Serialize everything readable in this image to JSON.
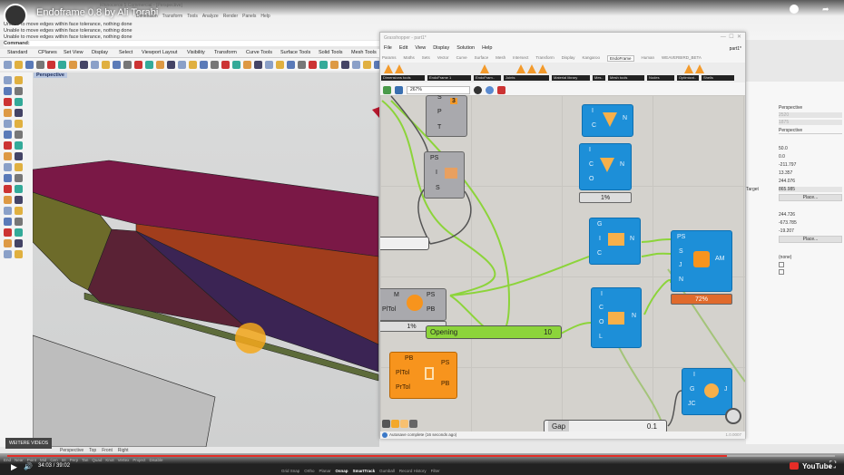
{
  "video": {
    "title": "Endoframe 0.8 by Ali Torabi",
    "time": "34:03 / 39:02",
    "more_videos": "WEITERE VIDEOS",
    "youtube": "YouTube",
    "progress_percent": 87
  },
  "rhino": {
    "window_title": "Rhinoceros 5 Commercial - [Perspective]",
    "menu": [
      "File",
      "Edit",
      "View",
      "Curve",
      "Surface",
      "Solid",
      "Mesh",
      "Dimension",
      "Transform",
      "Tools",
      "Analyze",
      "Render",
      "Panels",
      "Help"
    ],
    "command_history": [
      "Unable to move edges within face tolerance, nothing done",
      "Unable to move edges within face tolerance, nothing done",
      "Unable to move edges within face tolerance, nothing done"
    ],
    "command_label": "Command:",
    "tabs": [
      "Standard",
      "CPlanes",
      "Set View",
      "Display",
      "Select",
      "Viewport Layout",
      "Visibility",
      "Transform",
      "Curve Tools",
      "Surface Tools",
      "Solid Tools",
      "Mesh Tools"
    ],
    "viewport_label": "Perspective",
    "viewport_tabs": [
      "Perspective",
      "Top",
      "Front",
      "Right"
    ],
    "osnaps": [
      "End",
      "Near",
      "Point",
      "Mid",
      "Cen",
      "Int",
      "Perp",
      "Tan",
      "Quad",
      "Knot",
      "Vertex",
      "Project",
      "Disable"
    ],
    "status": [
      "Grid Snap",
      "Ortho",
      "Planar",
      "Osnap",
      "SmartTrack",
      "Gumball",
      "Record History",
      "Filter"
    ],
    "properties": {
      "title": "Perspective",
      "values": [
        "2520",
        "1875"
      ],
      "projection": "Perspective",
      "numbers": [
        "50.0",
        "0.0",
        "-211.797",
        "13.357",
        "244.076",
        "865.985"
      ],
      "target_label": "Target",
      "place_label": "Place...",
      "numbers2": [
        "244.726",
        "-673.785",
        "-19.207"
      ],
      "place2_label": "Place...",
      "none_label": "(none)"
    }
  },
  "grasshopper": {
    "title": "Grasshopper - part1*",
    "doc_name": "part1*",
    "menu": [
      "File",
      "Edit",
      "View",
      "Display",
      "Solution",
      "Help"
    ],
    "tabs": [
      "Params",
      "Maths",
      "Sets",
      "Vector",
      "Curve",
      "Surface",
      "Mesh",
      "Intersect",
      "Transform",
      "Display",
      "Kangaroo",
      "EndoFrame",
      "Human",
      "WEAVERBIRD_BETA"
    ],
    "active_tab": "EndoFrame",
    "ribbon_groups": [
      "Dimensions tools",
      "EndoFrame 1",
      "EndoFram..",
      "Joints",
      "Material library",
      "Mes..",
      "Mesh tools",
      "Nodes",
      "Optimizat..",
      "Shells"
    ],
    "zoom": "267%",
    "status": "Autosave complete (16 seconds ago)",
    "version": "1.0.0007",
    "nodes": {
      "n1": {
        "inputs": [
          "S",
          "P",
          "T"
        ],
        "badge": "3"
      },
      "n2": {
        "inputs": [
          "PS",
          "I",
          "S"
        ]
      },
      "n3": {
        "inputs": [
          "I",
          "C"
        ],
        "outputs": [
          "N"
        ]
      },
      "n4": {
        "inputs": [
          "I",
          "C",
          "O"
        ],
        "outputs": [
          "N"
        ],
        "progress": "1%"
      },
      "n5": {
        "inputs": [
          "G",
          "I",
          "C"
        ],
        "outputs": [
          "N"
        ]
      },
      "n6": {
        "inputs": [
          "PS",
          "S",
          "J",
          "N"
        ],
        "outputs": [
          "AM"
        ],
        "progress": "72%"
      },
      "n7": {
        "inputs": [
          "M",
          "PlTol"
        ],
        "outputs": [
          "PS",
          "PB"
        ],
        "progress": "1%"
      },
      "n8": {
        "inputs": [
          "I",
          "C",
          "O",
          "L"
        ],
        "outputs": [
          "N"
        ]
      },
      "n9": {
        "inputs": [
          "PB",
          "PlTol",
          "PrTol"
        ],
        "outputs": [
          "PS",
          "PB"
        ]
      },
      "n10": {
        "inputs": [
          "I",
          "G",
          "JC"
        ],
        "outputs": [
          "J"
        ]
      }
    },
    "sliders": {
      "opening": {
        "label": "Opening",
        "value": "10"
      },
      "gap": {
        "label": "Gap",
        "value": "0.1"
      }
    }
  },
  "colors": {
    "gh_blue": "#1d8fd8",
    "gh_orange": "#f7941d",
    "wire": "#8cd43a",
    "magenta": "#7a1846",
    "progress_red": "#e52d27"
  }
}
